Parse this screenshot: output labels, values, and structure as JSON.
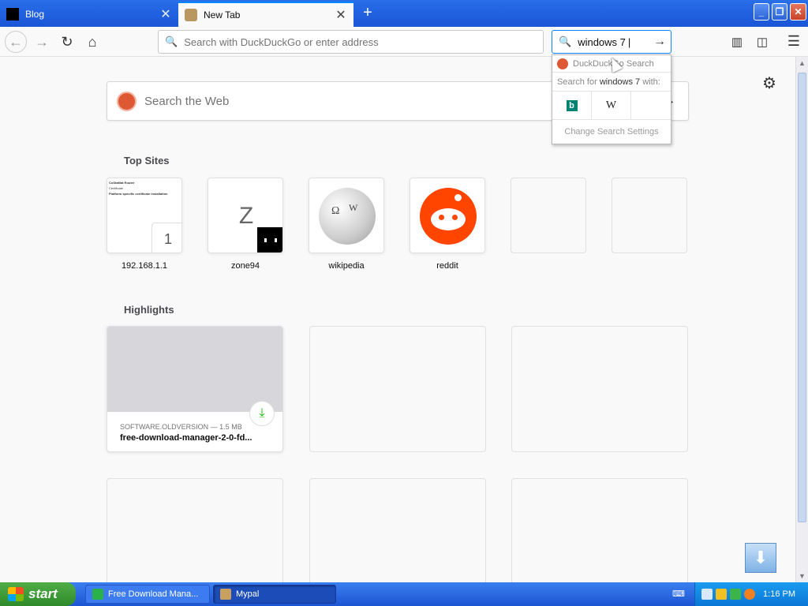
{
  "tabs": [
    {
      "title": "Blog",
      "active": false
    },
    {
      "title": "New Tab",
      "active": true
    }
  ],
  "navbar": {
    "url_placeholder": "Search with DuckDuckGo or enter address",
    "search_value": "windows 7"
  },
  "search_popup": {
    "engine": "DuckDuckGo Search",
    "search_for_prefix": "Search for",
    "search_for_query": "windows 7",
    "search_for_suffix": "with:",
    "change_settings": "Change Search Settings"
  },
  "newtab": {
    "search_placeholder": "Search the Web",
    "top_sites_title": "Top Sites",
    "highlights_title": "Highlights",
    "top_sites": [
      {
        "label": "192.168.1.1",
        "badge": "1"
      },
      {
        "label": "zone94",
        "letter": "Z"
      },
      {
        "label": "wikipedia"
      },
      {
        "label": "reddit"
      },
      {
        "label": ""
      },
      {
        "label": ""
      }
    ],
    "highlights": [
      {
        "source": "SOFTWARE.OLDVERSION — 1.5 MB",
        "title": "free-download-manager-2-0-fd..."
      }
    ],
    "thumb_lines": [
      "CoStaMat Router",
      "Certificate",
      "Platform specific certificate installation"
    ]
  },
  "taskbar": {
    "start": "start",
    "items": [
      "Free Download Mana...",
      "Mypal"
    ],
    "clock": "1:16 PM"
  },
  "colors": {
    "xp_blue": "#1a55d6",
    "firefox_accent": "#0a84ff",
    "duckduckgo": "#de5833",
    "reddit": "#ff4500",
    "download_green": "#12bc00"
  }
}
